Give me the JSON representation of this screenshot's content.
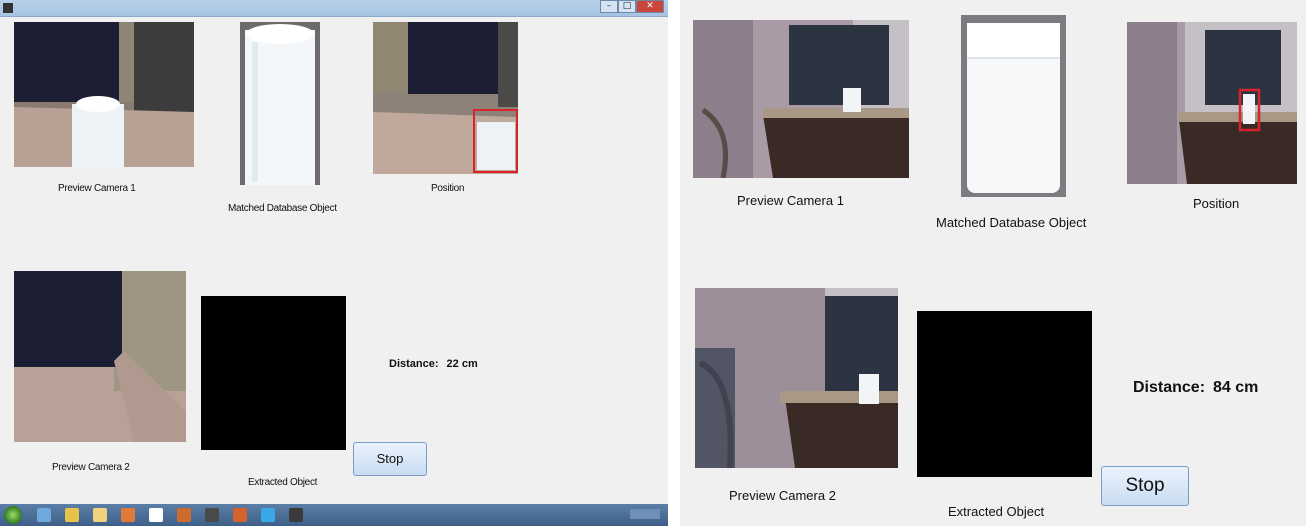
{
  "left": {
    "labels": {
      "preview1": "Preview Camera 1",
      "matched": "Matched Database Object",
      "position": "Position",
      "preview2": "Preview Camera 2",
      "extracted": "Extracted Object"
    },
    "distance_label": "Distance:",
    "distance_value": "22 cm",
    "stop_label": "Stop",
    "titlebar_buttons": [
      "–",
      "□",
      "✕"
    ],
    "taskbar_icons": [
      "explorer-icon",
      "ie-icon",
      "folder-icon",
      "media-icon",
      "app-icon",
      "firefox-icon",
      "camera-icon",
      "matlab-icon",
      "skype-icon",
      "webcam-icon"
    ]
  },
  "right": {
    "labels": {
      "preview1": "Preview Camera 1",
      "matched": "Matched Database Object",
      "position": "Position",
      "preview2": "Preview Camera 2",
      "extracted": "Extracted Object"
    },
    "distance_label": "Distance:",
    "distance_value": "84 cm",
    "stop_label": "Stop"
  },
  "colors": {
    "detection_box": "#d9232a",
    "extracted_bg": "#000000"
  }
}
